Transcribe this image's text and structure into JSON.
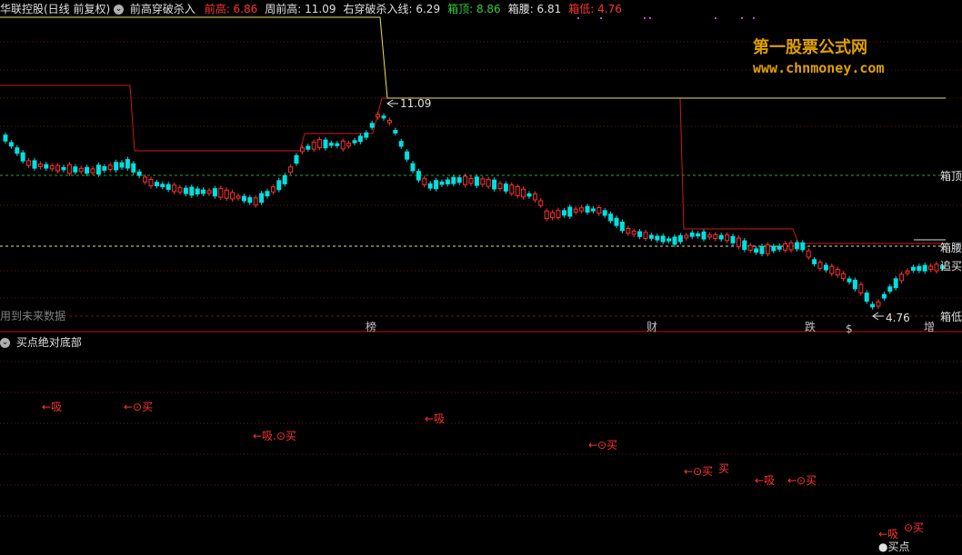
{
  "header": {
    "stock_title": "华联控股(日线 前复权)",
    "indicator_name": "前高穿破杀入",
    "items": [
      {
        "label": "前高:",
        "value": "6.86",
        "color": "#ff3333"
      },
      {
        "label": "周前高:",
        "value": "11.09",
        "color": "#e0e0e0"
      },
      {
        "label": "右穿破杀入线:",
        "value": "6.29",
        "color": "#e0e0e0"
      },
      {
        "label": "箱顶:",
        "value": "8.86",
        "color": "#33cc33"
      },
      {
        "label": "箱腰:",
        "value": "6.81",
        "color": "#e0e0e0"
      },
      {
        "label": "箱低:",
        "value": "4.76",
        "color": "#ff3333"
      }
    ]
  },
  "watermark": {
    "line1": "第一股票公式网",
    "line2": "www.chnmoney.com"
  },
  "main_chart": {
    "future_data_note": "用到未来数据",
    "high_label": "11.09",
    "low_label": "4.76",
    "right_labels": {
      "box_top": "箱顶",
      "box_mid": "箱腰",
      "chase": "追买",
      "box_low": "箱低"
    },
    "bottom_markers": [
      {
        "text": "榜",
        "color": "#ffaa00"
      },
      {
        "text": "财",
        "color": "#66aaff"
      },
      {
        "text": "跌",
        "color": "#33cc33"
      },
      {
        "text": "$",
        "color": "#ff3333"
      },
      {
        "text": "增",
        "color": "#ff66aa"
      }
    ]
  },
  "sub_chart": {
    "title": "买点绝对底部",
    "signals": [
      {
        "text": "←吸"
      },
      {
        "text": "←⊙买"
      },
      {
        "text": "←吸.⊙买"
      },
      {
        "text": "←吸"
      },
      {
        "text": "←⊙买"
      },
      {
        "text": "←⊙买"
      },
      {
        "text": "买"
      },
      {
        "text": "←吸"
      },
      {
        "text": "←⊙买"
      },
      {
        "text": "⊙买"
      },
      {
        "text": "←吸"
      }
    ],
    "buy_point": "●买点"
  },
  "colors": {
    "bull": "#ff3030",
    "bear": "#00e0e0",
    "red_line": "#d01818",
    "yellow_line": "#f0e060",
    "green_dash": "#22aa22",
    "grid": "#7a1010"
  }
}
